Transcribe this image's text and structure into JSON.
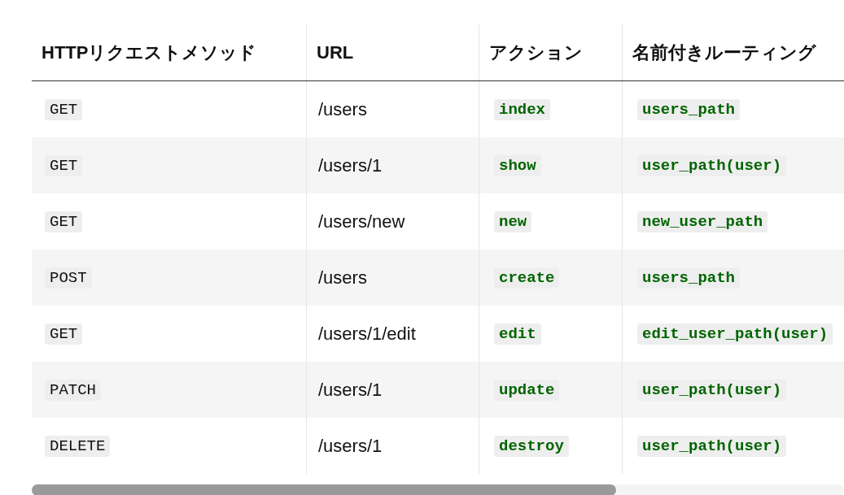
{
  "table": {
    "columns": [
      "HTTPリクエストメソッド",
      "URL",
      "アクション",
      "名前付きルーティング"
    ],
    "rows": [
      {
        "method": "GET",
        "url": "/users",
        "action": "index",
        "route": "users_path"
      },
      {
        "method": "GET",
        "url": "/users/1",
        "action": "show",
        "route": "user_path(user)"
      },
      {
        "method": "GET",
        "url": "/users/new",
        "action": "new",
        "route": "new_user_path"
      },
      {
        "method": "POST",
        "url": "/users",
        "action": "create",
        "route": "users_path"
      },
      {
        "method": "GET",
        "url": "/users/1/edit",
        "action": "edit",
        "route": "edit_user_path(user)"
      },
      {
        "method": "PATCH",
        "url": "/users/1",
        "action": "update",
        "route": "user_path(user)"
      },
      {
        "method": "DELETE",
        "url": "/users/1",
        "action": "destroy",
        "route": "user_path(user)"
      }
    ]
  }
}
